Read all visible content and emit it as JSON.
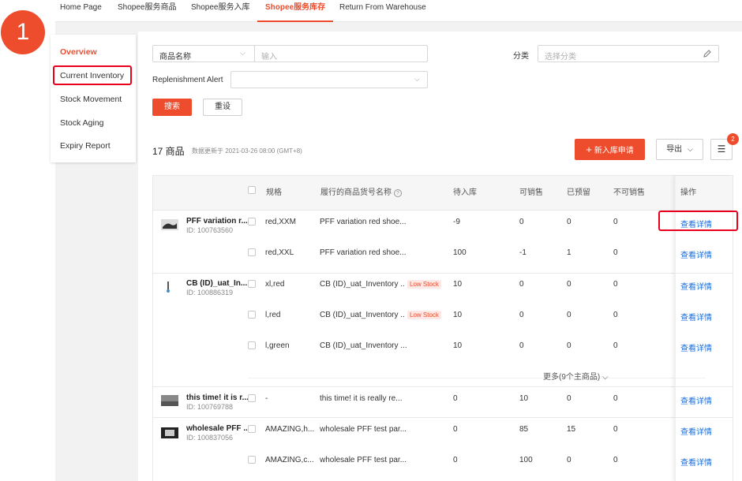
{
  "step_number": "1",
  "topnav": {
    "tabs": [
      {
        "label": "Home Page"
      },
      {
        "label": "Shopee服务商品"
      },
      {
        "label": "Shopee服务入库"
      },
      {
        "label": "Shopee服务库存"
      },
      {
        "label": "Return From Warehouse"
      }
    ],
    "active_index": 3
  },
  "sidebar": {
    "items": [
      {
        "label": "Overview"
      },
      {
        "label": "Current Inventory"
      },
      {
        "label": "Stock Movement"
      },
      {
        "label": "Stock Aging"
      },
      {
        "label": "Expiry Report"
      }
    ]
  },
  "filters": {
    "field_select": "商品名称",
    "keyword_placeholder": "输入",
    "category_label": "分类",
    "category_placeholder": "选择分类",
    "alert_label": "Replenishment Alert",
    "alert_value": "",
    "search_button": "搜索",
    "reset_button": "重设"
  },
  "summary": {
    "count_text": "17 商品",
    "updated_text": "数据更新于 2021-03-26 08:00 (GMT+8)",
    "new_inbound_button": "新入库申请",
    "export_button": "导出",
    "columns_badge": "2"
  },
  "table": {
    "headers": {
      "spec": "规格",
      "sku_name": "履行的商品货号名称",
      "inbound": "待入库",
      "sellable": "可销售",
      "reserved": "已预留",
      "unsellable": "不可销售",
      "actions": "操作"
    },
    "products": [
      {
        "name": "PFF variation r...",
        "id": "ID: 100763560"
      },
      {
        "name": "CB (ID)_uat_In...",
        "id": "ID: 100886319"
      },
      {
        "name": "this time! it is r...",
        "id": "ID: 100769788"
      },
      {
        "name": "wholesale PFF ...",
        "id": "ID: 100837056"
      }
    ],
    "rows": [
      {
        "spec": "red,XXM",
        "sku": "PFF variation red shoe...",
        "tag": "",
        "inbound": "-9",
        "sellable": "0",
        "reserved": "0",
        "unsellable": "0",
        "action": "查看详情"
      },
      {
        "spec": "red,XXL",
        "sku": "PFF variation red shoe...",
        "tag": "",
        "inbound": "100",
        "sellable": "-1",
        "reserved": "1",
        "unsellable": "0",
        "action": "查看详情"
      },
      {
        "spec": "xl,red",
        "sku": "CB (ID)_uat_Inventory ...",
        "tag": "Low Stock",
        "inbound": "10",
        "sellable": "0",
        "reserved": "0",
        "unsellable": "0",
        "action": "查看详情"
      },
      {
        "spec": "l,red",
        "sku": "CB (ID)_uat_Inventory ...",
        "tag": "Low Stock",
        "inbound": "10",
        "sellable": "0",
        "reserved": "0",
        "unsellable": "0",
        "action": "查看详情"
      },
      {
        "spec": "l,green",
        "sku": "CB (ID)_uat_Inventory ...",
        "tag": "",
        "inbound": "10",
        "sellable": "0",
        "reserved": "0",
        "unsellable": "0",
        "action": "查看详情"
      },
      {
        "spec": "-",
        "sku": "this time! it is really re...",
        "tag": "",
        "inbound": "0",
        "sellable": "10",
        "reserved": "0",
        "unsellable": "0",
        "action": "查看详情"
      },
      {
        "spec": "AMAZING,h...",
        "sku": "wholesale PFF test par...",
        "tag": "",
        "inbound": "0",
        "sellable": "85",
        "reserved": "15",
        "unsellable": "0",
        "action": "查看详情"
      },
      {
        "spec": "AMAZING,c...",
        "sku": "wholesale PFF test par...",
        "tag": "",
        "inbound": "0",
        "sellable": "100",
        "reserved": "0",
        "unsellable": "0",
        "action": "查看详情"
      }
    ],
    "more_text": "更多(9个主商品)"
  },
  "colors": {
    "brand": "#ee4d2d",
    "link": "#1a6ed8",
    "highlight": "#e8001c"
  }
}
